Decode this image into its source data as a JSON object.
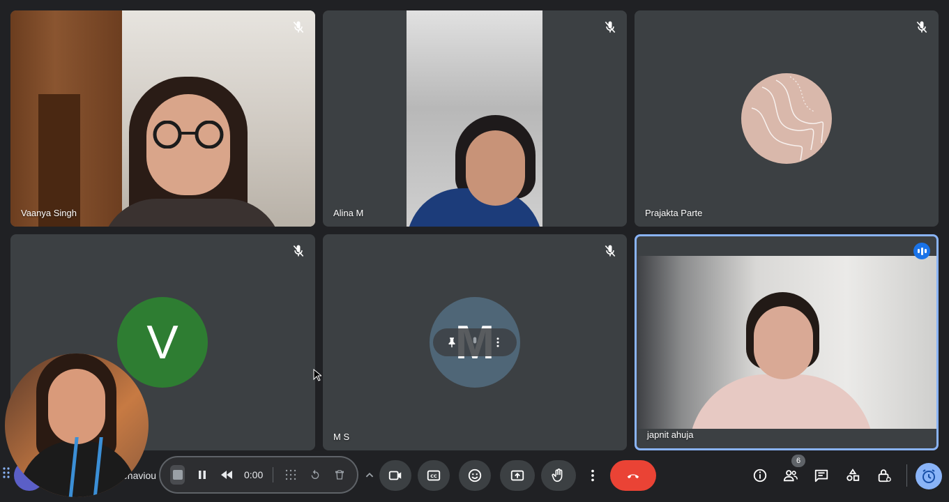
{
  "participants": [
    {
      "name": "Vaanya Singh",
      "muted": true
    },
    {
      "name": "Alina M",
      "muted": true
    },
    {
      "name": "Prajakta Parte",
      "muted": true
    },
    {
      "name": "",
      "avatar_letter": "V",
      "muted": true
    },
    {
      "name": "M S",
      "avatar_letter": "M",
      "muted": true
    },
    {
      "name": "japnit ahuja",
      "speaking": true
    }
  ],
  "meeting": {
    "name_partial": "ehaviou"
  },
  "recorder": {
    "time": "0:00"
  },
  "people": {
    "count": "6"
  },
  "icons": {
    "mic_off": "mic-off-icon",
    "speaking": "speaking-indicator-icon",
    "camera": "camera-icon",
    "captions": "closed-captions-icon",
    "emoji": "emoji-icon",
    "present": "present-screen-icon",
    "hand": "raise-hand-icon",
    "more": "more-vertical-icon",
    "end_call": "end-call-icon",
    "info": "info-icon",
    "people": "people-icon",
    "chat": "chat-icon",
    "activities": "activities-icon",
    "host_controls": "host-controls-icon",
    "timer": "timer-icon"
  },
  "colors": {
    "background": "#202124",
    "tile": "#3c4043",
    "end_call": "#ea4335",
    "accent": "#8ab4f8",
    "speaking_badge": "#1a73e8",
    "avatar_v": "#2e7d32",
    "avatar_m": "#4f6677"
  }
}
